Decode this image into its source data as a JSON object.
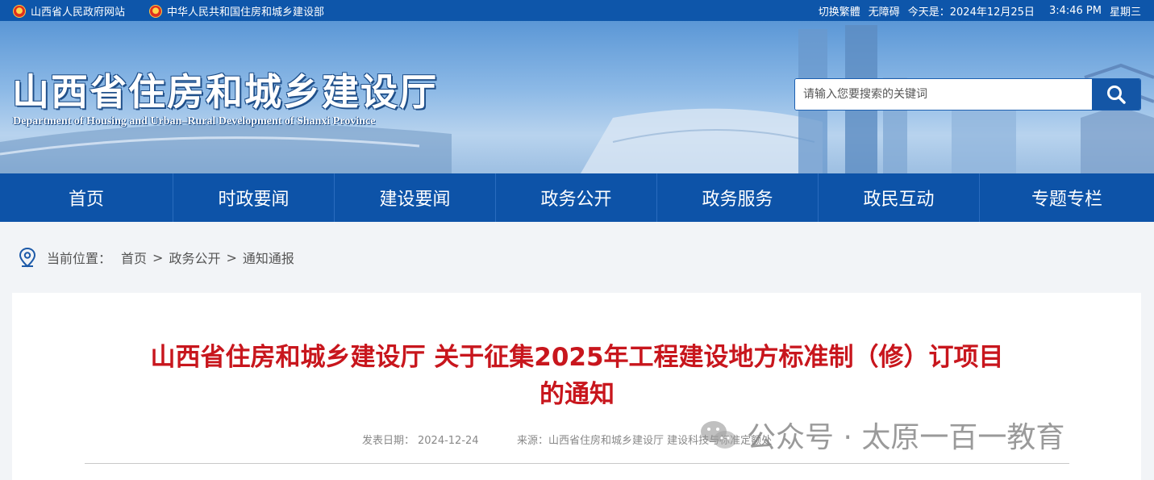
{
  "topbar": {
    "gov_site": "山西省人民政府网站",
    "ministry_site": "中华人民共和国住房和城乡建设部",
    "traditional": "切换繁體",
    "accessibility": "无障碍",
    "today_prefix": "今天是：",
    "date": "2024年12月25日",
    "time": "3:4:46  PM",
    "weekday": "星期三"
  },
  "header": {
    "title": "山西省住房和城乡建设厅",
    "subtitle": "Department of Housing and Urban–Rural Development of Shanxi Province",
    "search_placeholder": "请输入您要搜索的关键词"
  },
  "nav": {
    "items": [
      "首页",
      "时政要闻",
      "建设要闻",
      "政务公开",
      "政务服务",
      "政民互动",
      "专题专栏"
    ]
  },
  "breadcrumb": {
    "label": "当前位置：",
    "home": "首页",
    "section": "政务公开",
    "current": "通知通报",
    "sep": ">"
  },
  "article": {
    "title_line1": "山西省住房和城乡建设厅 关于征集2025年工程建设地方标准制（修）订项目",
    "title_line2": "的通知",
    "date_label": "发表日期：",
    "date_value": "2024-12-24",
    "source_label": "来源：",
    "source_value": "山西省住房和城乡建设厅 建设科技与标准定额处"
  },
  "watermark": {
    "text": "公众号 · 太原一百一教育",
    "icon": "wechat-icon"
  },
  "colors": {
    "primary_blue": "#0d53a8",
    "title_red": "#c8161d"
  }
}
